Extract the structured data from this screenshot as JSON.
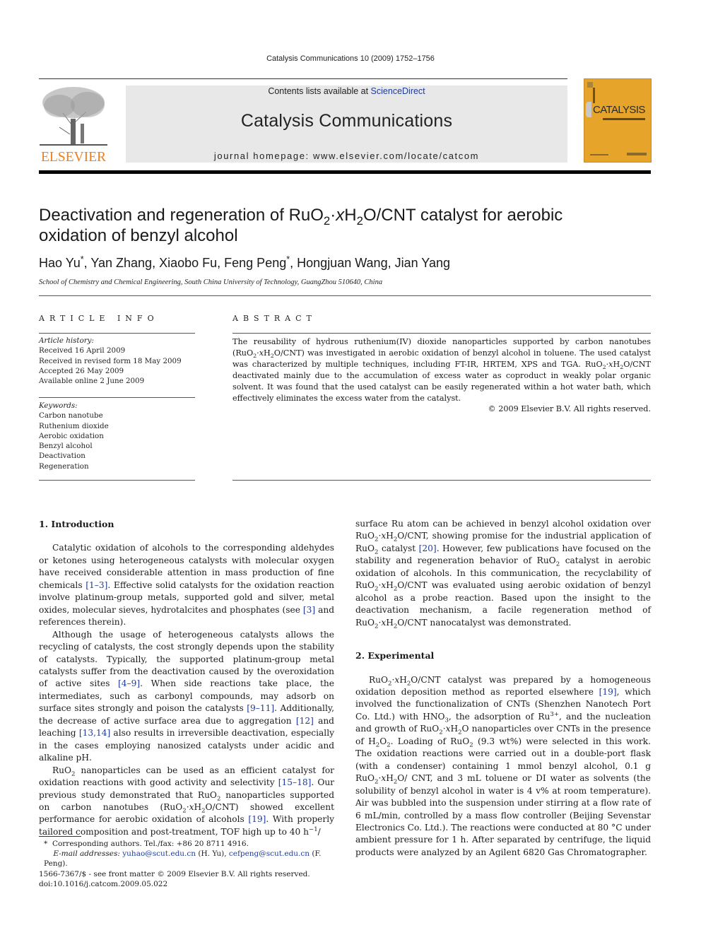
{
  "header": {
    "citation": "Catalysis Communications 10 (2009) 1752–1756",
    "contents_prefix": "Contents lists available at ",
    "sciencedirect": "ScienceDirect",
    "journal_title": "Catalysis Communications",
    "homepage": "journal homepage: www.elsevier.com/locate/catcom",
    "publisher": "ELSEVIER",
    "cover_title": "CATALYSIS"
  },
  "article": {
    "title_line1_a": "Deactivation and regeneration of RuO",
    "title_line1_b": "·",
    "title_line1_c": "x",
    "title_line1_d": "H",
    "title_line1_e": "O/CNT catalyst for aerobic",
    "title_line2": "oxidation of benzyl alcohol",
    "sub2": "2",
    "authors": [
      {
        "name": "Hao Yu",
        "corr": "*"
      },
      {
        "name": "Yan Zhang",
        "corr": ""
      },
      {
        "name": "Xiaobo Fu",
        "corr": ""
      },
      {
        "name": "Feng Peng",
        "corr": "*"
      },
      {
        "name": "Hongjuan Wang",
        "corr": ""
      },
      {
        "name": "Jian Yang",
        "corr": ""
      }
    ],
    "affiliation": "School of Chemistry and Chemical Engineering, South China University of Technology, GuangZhou 510640, China"
  },
  "article_info": {
    "heading": "ARTICLE INFO",
    "history_label": "Article history:",
    "history": [
      "Received 16 April 2009",
      "Received in revised form 18 May 2009",
      "Accepted 26 May 2009",
      "Available online 2 June 2009"
    ],
    "keywords_label": "Keywords:",
    "keywords": [
      "Carbon nanotube",
      "Ruthenium dioxide",
      "Aerobic oxidation",
      "Benzyl alcohol",
      "Deactivation",
      "Regeneration"
    ]
  },
  "abstract": {
    "heading": "ABSTRACT",
    "copyright": "© 2009 Elsevier B.V. All rights reserved."
  },
  "sections": {
    "intro_heading": "1. Introduction",
    "exp_heading": "2. Experimental"
  },
  "footnotes": {
    "corr": "Corresponding authors. Tel./fax: +86 20 8711 4916.",
    "email_label": "E-mail addresses:",
    "email1": "yuhao@scut.edu.cn",
    "email1_who": " (H. Yu), ",
    "email2": "cefpeng@scut.edu.cn",
    "email2_who": " (F. Peng).",
    "issn": "1566-7367/$ - see front matter © 2009 Elsevier B.V. All rights reserved.",
    "doi": "doi:10.1016/j.catcom.2009.05.022"
  }
}
